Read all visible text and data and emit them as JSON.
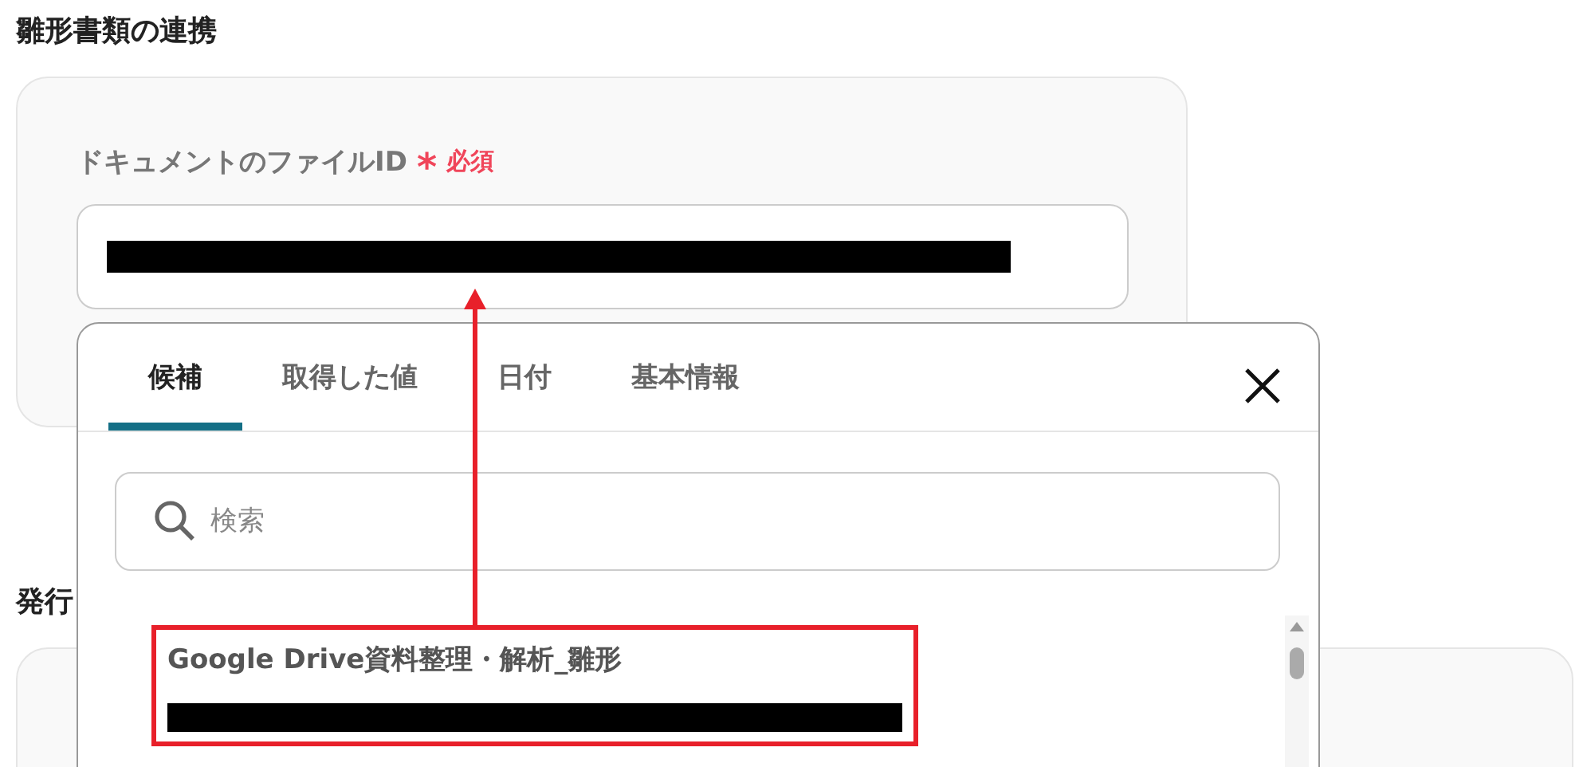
{
  "page_title": "雛形書類の連携",
  "field": {
    "label": "ドキュメントのファイルID",
    "required_mark": "*",
    "required_label": "必須",
    "value_redacted": true
  },
  "section_2": {
    "title": "発行"
  },
  "popup": {
    "tabs": [
      {
        "label": "候補",
        "selected": true
      },
      {
        "label": "取得した値",
        "selected": false
      },
      {
        "label": "日付",
        "selected": false
      },
      {
        "label": "基本情報",
        "selected": false
      }
    ],
    "search": {
      "placeholder": "検索"
    },
    "items": [
      {
        "title": "Google Drive資料整理・解析_雛形",
        "subtitle_redacted": true,
        "highlighted": true
      }
    ]
  }
}
